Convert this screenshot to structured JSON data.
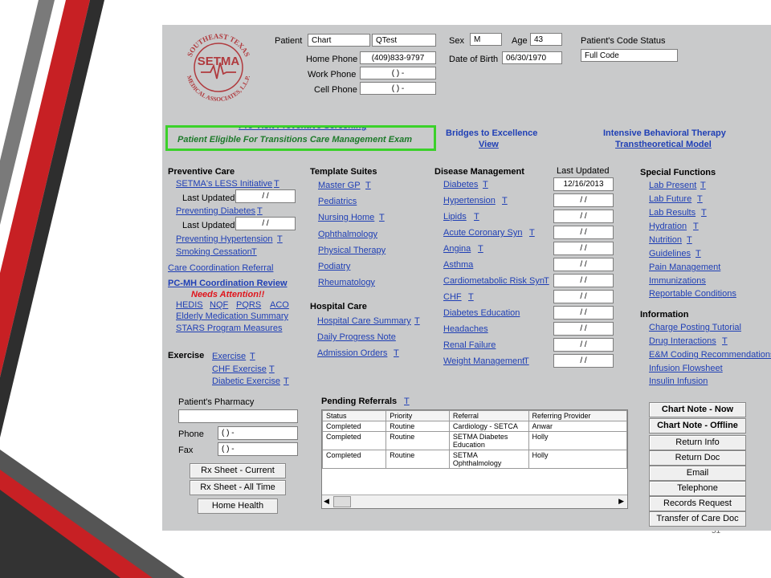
{
  "slide": {
    "page_number": "51"
  },
  "patient": {
    "labels": {
      "patient": "Patient",
      "home_phone": "Home Phone",
      "work_phone": "Work Phone",
      "cell_phone": "Cell Phone",
      "sex": "Sex",
      "age": "Age",
      "dob": "Date of Birth",
      "code_status": "Patient's Code Status"
    },
    "first_name": "Chart",
    "last_name": "QTest",
    "home_phone": "(409)833-9797",
    "work_phone": "(   )   -",
    "cell_phone": "(   )   -",
    "sex": "M",
    "age": "43",
    "dob": "06/30/1970",
    "code_status": "Full Code"
  },
  "logo": {
    "top_text": "SOUTHEAST TEXAS",
    "bottom_text": "MEDICAL ASSOCIATES, L.L.P.",
    "mark": "SETMA"
  },
  "banner": {
    "partial_text": "Pre-Visit Preventive Screening",
    "eligible_text": "Patient Eligible For Transitions Care Management Exam",
    "bridges": "Bridges to Excellence",
    "bridges_view": "View",
    "ibt": "Intensive Behavioral Therapy",
    "ibt_model": "Transtheoretical Model"
  },
  "t": "T",
  "preventive": {
    "header": "Preventive Care",
    "less": "SETMA's LESS Initiative",
    "last_updated_label": "Last Updated",
    "less_date": "/  /",
    "diabetes": "Preventing Diabetes",
    "diabetes_date": "/  /",
    "hypertension": "Preventing Hypertension",
    "smoking": "Smoking Cessation",
    "care_coord": "Care Coordination Referral",
    "pcmh": "PC-MH Coordination Review",
    "needs_attention": "Needs Attention!!",
    "hedis": "HEDIS",
    "nqf": "NQF",
    "pqrs": "PQRS",
    "aco": "ACO",
    "elderly": "Elderly Medication Summary",
    "stars": "STARS Program Measures"
  },
  "exercise": {
    "header": "Exercise",
    "exercise": "Exercise",
    "chf": "CHF Exercise",
    "diabetic": "Diabetic Exercise"
  },
  "templates": {
    "header": "Template Suites",
    "items": [
      "Master GP",
      "Pediatrics",
      "Nursing Home",
      "Ophthalmology",
      "Physical Therapy",
      "Podiatry",
      "Rheumatology"
    ]
  },
  "hospital": {
    "header": "Hospital Care",
    "items": [
      "Hospital Care Summary",
      "Daily Progress Note",
      "Admission Orders"
    ]
  },
  "disease": {
    "header": "Disease Management",
    "last_updated_header": "Last Updated",
    "items": [
      {
        "label": "Diabetes",
        "date": "12/16/2013"
      },
      {
        "label": "Hypertension",
        "date": "/  /"
      },
      {
        "label": "Lipids",
        "date": "/  /"
      },
      {
        "label": "Acute Coronary Syn",
        "date": "/  /"
      },
      {
        "label": "Angina",
        "date": "/  /"
      },
      {
        "label": "Asthma",
        "date": "/  /"
      },
      {
        "label": "Cardiometabolic Risk Syn",
        "date": "/  /"
      },
      {
        "label": "CHF",
        "date": "/  /"
      },
      {
        "label": "Diabetes Education",
        "date": "/  /"
      },
      {
        "label": "Headaches",
        "date": "/  /"
      },
      {
        "label": "Renal Failure",
        "date": "/  /"
      },
      {
        "label": "Weight Management",
        "date": "/  /"
      }
    ]
  },
  "special": {
    "header": "Special Functions",
    "items": [
      "Lab Present",
      "Lab Future",
      "Lab Results",
      "Hydration",
      "Nutrition",
      "Guidelines",
      "Pain Management",
      "Immunizations",
      "Reportable Conditions"
    ]
  },
  "information": {
    "header": "Information",
    "items": [
      "Charge Posting Tutorial",
      "Drug Interactions",
      "E&M Coding Recommendations",
      "Infusion Flowsheet",
      "Insulin Infusion"
    ]
  },
  "pharmacy": {
    "header": "Patient's Pharmacy",
    "name": "",
    "phone_label": "Phone",
    "fax_label": "Fax",
    "phone": "(   )   -",
    "fax": "(   )   -",
    "rx_current": "Rx Sheet - Current",
    "rx_all": "Rx Sheet - All Time",
    "home_health": "Home Health"
  },
  "referrals": {
    "header": "Pending Referrals",
    "columns": [
      "Status",
      "Priority",
      "Referral",
      "Referring Provider"
    ],
    "rows": [
      [
        "Completed",
        "Routine",
        "Cardiology - SETCA",
        "Anwar"
      ],
      [
        "Completed",
        "Routine",
        "SETMA Diabetes Education",
        "Holly"
      ],
      [
        "Completed",
        "Routine",
        "SETMA Ophthalmology",
        "Holly"
      ]
    ]
  },
  "actions": [
    "Chart Note - Now",
    "Chart Note - Offline",
    "Return Info",
    "Return Doc",
    "Email",
    "Telephone",
    "Records Request",
    "Transfer of Care Doc"
  ],
  "colors": {
    "panel": "#c9cacb",
    "link": "#1f3fb5",
    "highlight": "#3bd12a",
    "alert": "#e0141b",
    "logo": "#b03a3e"
  }
}
